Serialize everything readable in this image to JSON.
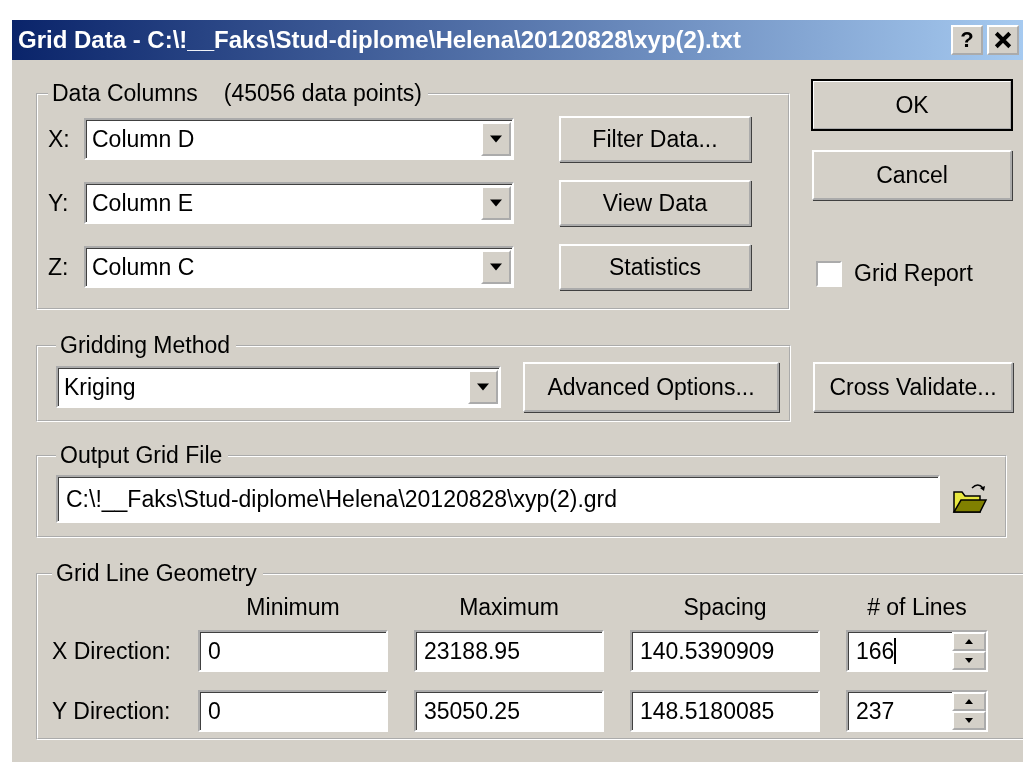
{
  "window": {
    "title": "Grid Data - C:\\!__Faks\\Stud-diplome\\Helena\\20120828\\xyp(2).txt",
    "help_button": "?"
  },
  "data_columns": {
    "label": "Data Columns",
    "count": "(45056 data points)",
    "rows": [
      {
        "axis": "X:",
        "value": "Column D",
        "button": "Filter Data..."
      },
      {
        "axis": "Y:",
        "value": "Column E",
        "button": "View Data"
      },
      {
        "axis": "Z:",
        "value": "Column C",
        "button": "Statistics"
      }
    ]
  },
  "dialog_buttons": [
    "OK",
    "Cancel"
  ],
  "grid_report": {
    "label": "Grid Report",
    "checked": false
  },
  "gridding_method": {
    "label": "Gridding Method",
    "value": "Kriging",
    "button": "Advanced Options..."
  },
  "cross_validate": "Cross Validate...",
  "output_grid_file": {
    "label": "Output Grid File",
    "value": "C:\\!__Faks\\Stud-diplome\\Helena\\20120828\\xyp(2).grd"
  },
  "grid_line_geometry": {
    "label": "Grid Line Geometry",
    "columns": [
      "Minimum",
      "Maximum",
      "Spacing",
      "# of Lines"
    ],
    "rows": [
      {
        "label": "X Direction:",
        "values": [
          "0",
          "23188.95",
          "140.5390909"
        ],
        "lines": "166",
        "focused": true
      },
      {
        "label": "Y Direction:",
        "values": [
          "0",
          "35050.25",
          "148.5180085"
        ],
        "lines": "237",
        "focused": false
      }
    ]
  }
}
